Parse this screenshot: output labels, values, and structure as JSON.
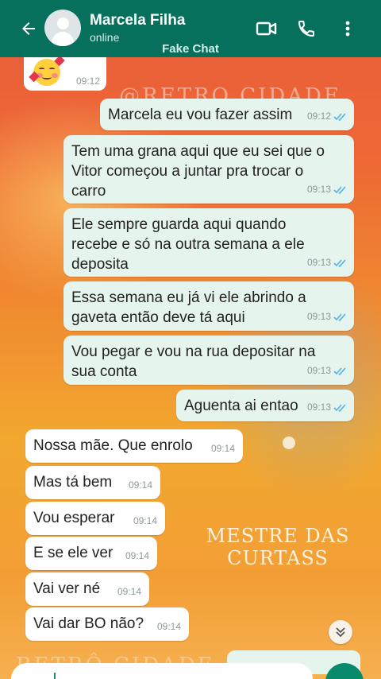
{
  "header": {
    "contact_name": "Marcela Filha",
    "status": "online",
    "subtitle": "Fake Chat",
    "icons": [
      "back-arrow-icon",
      "avatar",
      "video-call-icon",
      "phone-icon",
      "more-vert-icon"
    ],
    "color": "#07705d"
  },
  "messages": [
    {
      "direction": "in",
      "text": "",
      "emoji": "smiling-face-with-hearts",
      "time": "09:12"
    },
    {
      "direction": "out",
      "text": "Marcela eu vou fazer assim",
      "time": "09:12",
      "read": true
    },
    {
      "direction": "out",
      "text": "Tem uma grana aqui que eu sei que o Vitor  começou a juntar pra trocar o carro",
      "time": "09:13",
      "read": true
    },
    {
      "direction": "out",
      "text": "Ele sempre guarda aqui quando recebe e só na outra semana a ele deposita",
      "time": "09:13",
      "read": true
    },
    {
      "direction": "out",
      "text": "Essa semana eu já vi ele abrindo a gaveta então deve tá aqui",
      "time": "09:13",
      "read": true
    },
    {
      "direction": "out",
      "text": "Vou pegar e vou na rua depositar na sua conta",
      "time": "09:13",
      "read": true
    },
    {
      "direction": "out",
      "text": "Aguenta ai entao",
      "time": "09:13",
      "read": true
    },
    {
      "direction": "in",
      "text": "Nossa mãe. Que enrolo",
      "time": "09:14"
    },
    {
      "direction": "in",
      "text": "Mas tá bem",
      "time": "09:14"
    },
    {
      "direction": "in",
      "text": "Vou esperar",
      "time": "09:14"
    },
    {
      "direction": "in",
      "text": "E se ele ver",
      "time": "09:14"
    },
    {
      "direction": "in",
      "text": "Vai ver né",
      "time": "09:14"
    },
    {
      "direction": "in",
      "text": "Vai dar BO não?",
      "time": "09:14"
    }
  ],
  "overlays": {
    "mestre": "MESTRE DAS CURTASS",
    "retro_top": "@RETRO CIDADE",
    "retro_bottom": "RETRÔ CIDADE"
  },
  "colors": {
    "outgoing_bubble": "#e6f4ee",
    "incoming_bubble": "#ffffff",
    "read_ticks": "#4fb3e8"
  }
}
